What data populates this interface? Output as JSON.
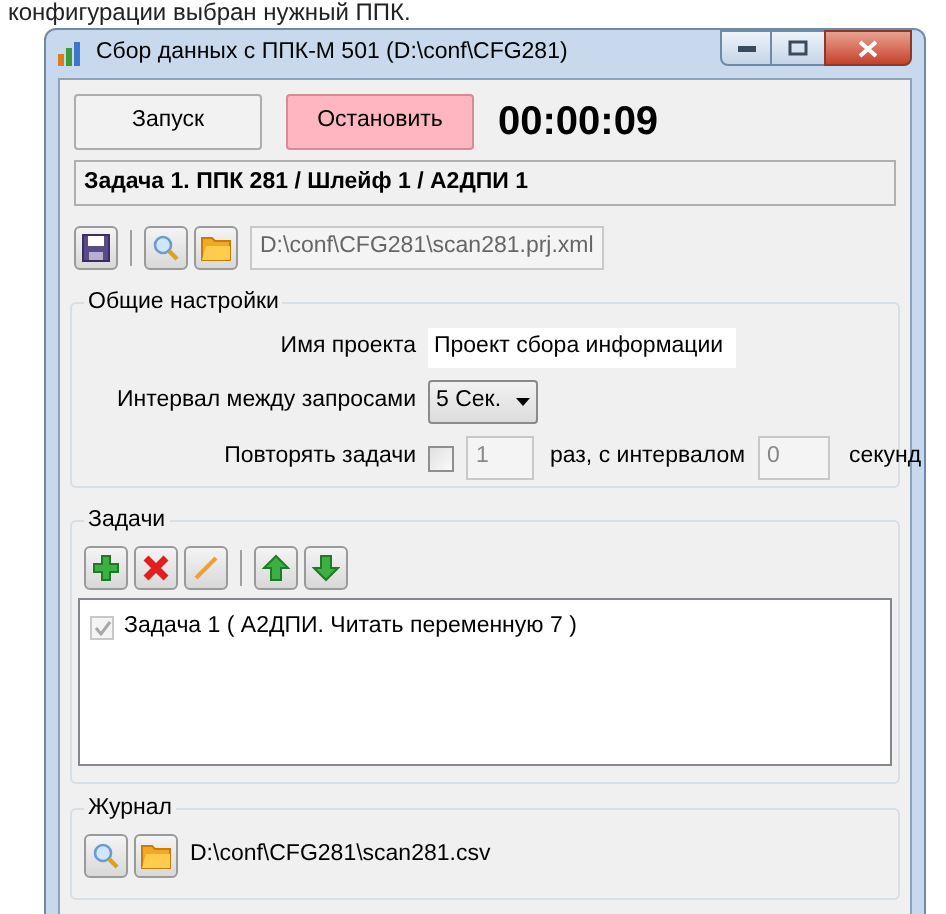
{
  "background_text": "конфигурации выбран нужный ППК.",
  "window": {
    "title": "Сбор данных с ППК-М 501 (D:\\conf\\CFG281)"
  },
  "run": {
    "start_button": "Запуск",
    "stop_button": "Остановить",
    "timer": "00:00:09"
  },
  "status": "Задача 1. ППК 281 / Шлейф 1 / А2ДПИ 1",
  "project_file": {
    "value": "D:\\conf\\CFG281\\scan281.prj.xml"
  },
  "general_settings": {
    "title": "Общие настройки",
    "project_name": {
      "label": "Имя проекта",
      "value": "Проект сбора информации"
    },
    "interval": {
      "label": "Интервал между запросами",
      "value": "5 Сек."
    },
    "repeat": {
      "label": "Повторять задачи",
      "checked": false,
      "count": "1",
      "middle_label": "раз, с интервалом",
      "interval": "0",
      "unit_label": "секунд"
    }
  },
  "tasks": {
    "title": "Задачи",
    "items": [
      {
        "label": "Задача 1 ( А2ДПИ. Читать переменную 7 )",
        "checked": true,
        "disabled": true
      }
    ]
  },
  "journal": {
    "title": "Журнал",
    "file": "D:\\conf\\CFG281\\scan281.csv"
  }
}
